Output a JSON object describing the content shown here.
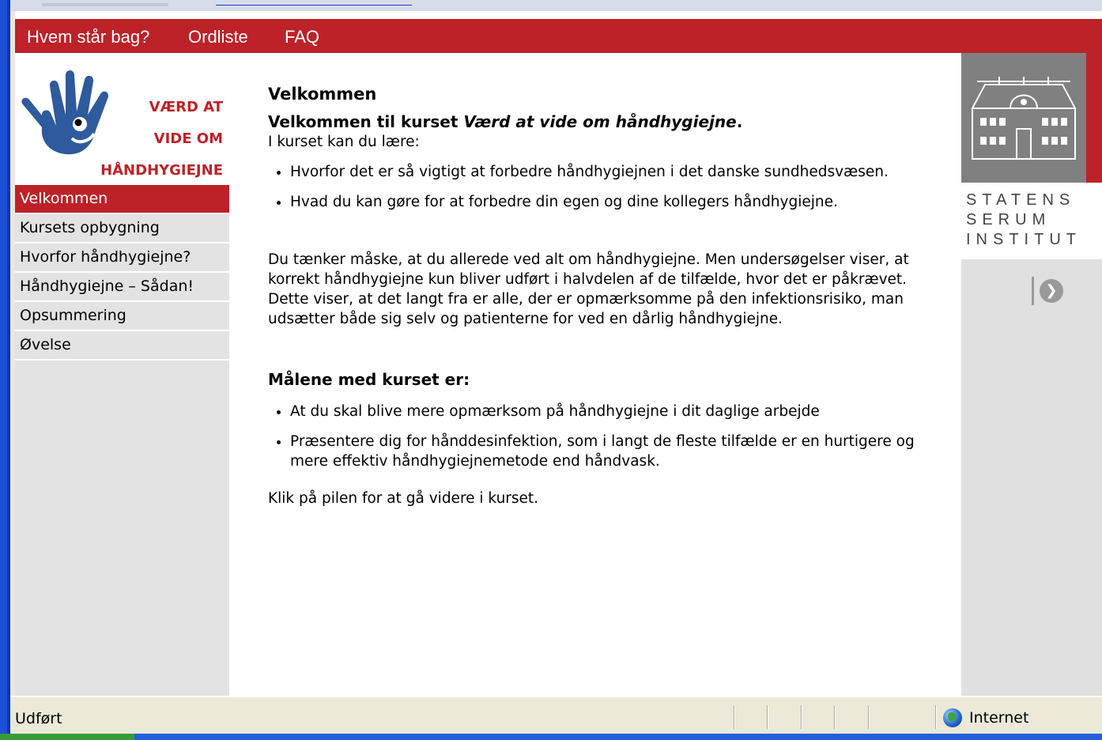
{
  "nav": {
    "items": [
      "Hvem står bag?",
      "Ordliste",
      "FAQ"
    ]
  },
  "logo": {
    "lines": [
      "VÆRD AT",
      "VIDE OM",
      "HÅNDHYGIEJNE"
    ],
    "brand_color": "#bc2228"
  },
  "sidebar": {
    "items": [
      {
        "label": "Velkommen",
        "active": true
      },
      {
        "label": "Kursets opbygning",
        "active": false
      },
      {
        "label": "Hvorfor håndhygiejne?",
        "active": false
      },
      {
        "label": "Håndhygiejne – Sådan!",
        "active": false
      },
      {
        "label": "Opsummering",
        "active": false
      },
      {
        "label": "Øvelse",
        "active": false
      }
    ]
  },
  "main": {
    "title": "Velkommen",
    "intro_prefix": "Velkommen til kurset ",
    "intro_course": "Værd at vide om håndhygiejne",
    "intro_suffix": ".",
    "learn_intro": "I kurset kan du lære:",
    "learn_items": [
      "Hvorfor det er så vigtigt at forbedre håndhygiejnen i det danske sundhedsvæsen.",
      "Hvad du kan gøre for at forbedre din egen og dine kollegers håndhygiejne."
    ],
    "paragraph": "Du tænker måske, at du allerede ved alt om håndhygiejne. Men undersøgelser viser, at korrekt håndhygiejne kun bliver udført i halvdelen af de tilfælde, hvor det er påkrævet. Dette viser, at det langt fra er alle, der er opmærksomme på den infektionsrisiko, man udsætter både sig selv og patienterne for ved en dårlig håndhygiejne.",
    "goals_heading": "Målene med kurset er:",
    "goals_items": [
      "At du skal blive mere opmærksom på håndhygiejne i dit daglige arbejde",
      "Præsentere dig for hånddesinfektion, som i langt de fleste tilfælde er en hurtigere og mere effektiv håndhygiejnemetode end håndvask."
    ],
    "closing": "Klik på pilen for at gå videre i kurset."
  },
  "right_panel": {
    "org_lines": [
      "STATENS",
      "SERUM",
      "INSTITUT"
    ],
    "next_icon": "arrow-right-circle-icon"
  },
  "statusbar": {
    "status": "Udført",
    "zone": "Internet",
    "zone_icon": "globe-icon"
  }
}
